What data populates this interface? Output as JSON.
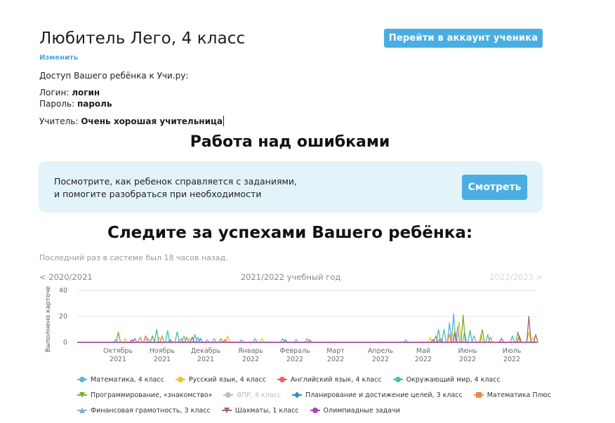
{
  "header": {
    "child_name": "Любитель Лего, 4 класс",
    "change_label": "Изменить",
    "account_button": "Перейти в аккаунт ученика"
  },
  "access": {
    "title": "Доступ Вашего ребёнка к Учи.ру:",
    "login_label": "Логин:",
    "login_value": "логин",
    "password_label": "Пароль:",
    "password_value": "пароль",
    "teacher_label": "Учитель:",
    "teacher_value": "Очень хорошая учительница"
  },
  "errors_section": {
    "title": "Работа над ошибками",
    "banner_line1": "Посмотрите, как ребенок справляется с заданиями,",
    "banner_line2": "и помогите разобраться при необходимости",
    "watch_button": "Смотреть"
  },
  "progress_section": {
    "title": "Следите за успехами Вашего ребёнка:",
    "last_seen": "Последний раз в системе был 18 часов назад.",
    "prev_year": "< 2020/2021",
    "current_year": "2021/2022 учебный год",
    "next_year": "2022/2023 >"
  },
  "chart_data": {
    "type": "line",
    "ylabel": "Выполнено карточе",
    "ylim": [
      0,
      40
    ],
    "y_ticks": [
      "0",
      "20",
      "40"
    ],
    "x_ticks": [
      {
        "month": "Октябрь",
        "year": "2021"
      },
      {
        "month": "Ноябрь",
        "year": "2021"
      },
      {
        "month": "Декабрь",
        "year": "2021"
      },
      {
        "month": "Январь",
        "year": "2022"
      },
      {
        "month": "Февраль",
        "year": "2022"
      },
      {
        "month": "Март",
        "year": "2022"
      },
      {
        "month": "Апрель",
        "year": "2022"
      },
      {
        "month": "Май",
        "year": "2022"
      },
      {
        "month": "Июнь",
        "year": "2022"
      },
      {
        "month": "Июль",
        "year": "2022"
      }
    ],
    "x_range_days": [
      0,
      336
    ],
    "series": [
      {
        "name": "Математика, 4 класс",
        "color": "#5ab4e0",
        "marker": "circle",
        "enabled": true,
        "points": [
          [
            28,
            2
          ],
          [
            78,
            5
          ],
          [
            88,
            4
          ],
          [
            100,
            3
          ],
          [
            120,
            2
          ],
          [
            150,
            3
          ],
          [
            160,
            2
          ],
          [
            168,
            3
          ],
          [
            240,
            2
          ],
          [
            268,
            10
          ],
          [
            272,
            15
          ],
          [
            275,
            22
          ],
          [
            278,
            12
          ],
          [
            283,
            8
          ],
          [
            290,
            5
          ]
        ]
      },
      {
        "name": "Русский язык, 4 класс",
        "color": "#f2c12e",
        "marker": "circle",
        "enabled": true,
        "points": [
          [
            35,
            3
          ],
          [
            60,
            4
          ],
          [
            82,
            3
          ],
          [
            110,
            5
          ],
          [
            135,
            3
          ],
          [
            258,
            4
          ],
          [
            274,
            9
          ],
          [
            279,
            16
          ],
          [
            295,
            6
          ],
          [
            330,
            8
          ],
          [
            333,
            4
          ]
        ]
      },
      {
        "name": "Английский язык, 4 класс",
        "color": "#e8606a",
        "marker": "circle",
        "enabled": true,
        "points": [
          [
            50,
            5
          ],
          [
            76,
            3
          ],
          [
            108,
            2
          ],
          [
            170,
            2
          ],
          [
            265,
            3
          ]
        ]
      },
      {
        "name": "Окружающий мир, 4 класс",
        "color": "#3dc4a8",
        "marker": "circle",
        "enabled": true,
        "points": [
          [
            58,
            10
          ],
          [
            66,
            9
          ],
          [
            73,
            8
          ],
          [
            86,
            6
          ],
          [
            130,
            3
          ],
          [
            264,
            10
          ],
          [
            287,
            9
          ],
          [
            300,
            6
          ],
          [
            318,
            5
          ]
        ]
      },
      {
        "name": "Программирование, «знакомство»",
        "color": "#7bab3a",
        "marker": "triangle",
        "enabled": true,
        "points": [
          [
            30,
            8
          ],
          [
            55,
            5
          ],
          [
            80,
            4
          ],
          [
            105,
            3
          ],
          [
            262,
            5
          ],
          [
            282,
            21
          ],
          [
            296,
            10
          ],
          [
            322,
            8
          ]
        ]
      },
      {
        "name": "ВПР, 4 класс",
        "color": "#c0c0c0",
        "marker": "circle",
        "enabled": false,
        "points": []
      },
      {
        "name": "Планирование и достижение целей, 3 класс",
        "color": "#2f8fb0",
        "marker": "diamond",
        "enabled": true,
        "points": [
          [
            42,
            3
          ],
          [
            68,
            2
          ],
          [
            90,
            3
          ],
          [
            152,
            2
          ]
        ]
      },
      {
        "name": "Математика Плюс",
        "color": "#e58a4a",
        "marker": "square",
        "enabled": true,
        "points": [
          [
            46,
            4
          ],
          [
            62,
            5
          ],
          [
            272,
            6
          ],
          [
            302,
            4
          ]
        ]
      },
      {
        "name": "Финансовая грамотность, 3 класс",
        "color": "#8fa8d4",
        "marker": "triangle-up",
        "enabled": true,
        "points": [
          [
            52,
            3
          ],
          [
            95,
            2
          ],
          [
            266,
            3
          ]
        ]
      },
      {
        "name": "Шахматы, 1 класс",
        "color": "#9b6d66",
        "marker": "triangle",
        "enabled": true,
        "points": [
          [
            84,
            4
          ],
          [
            276,
            8
          ],
          [
            323,
            5
          ],
          [
            330,
            20
          ],
          [
            335,
            6
          ]
        ]
      },
      {
        "name": "Олимпиадные задачи",
        "color": "#b043b6",
        "marker": "circle",
        "enabled": true,
        "points": [
          [
            40,
            2
          ],
          [
            260,
            2
          ],
          [
            310,
            3
          ]
        ]
      }
    ]
  }
}
